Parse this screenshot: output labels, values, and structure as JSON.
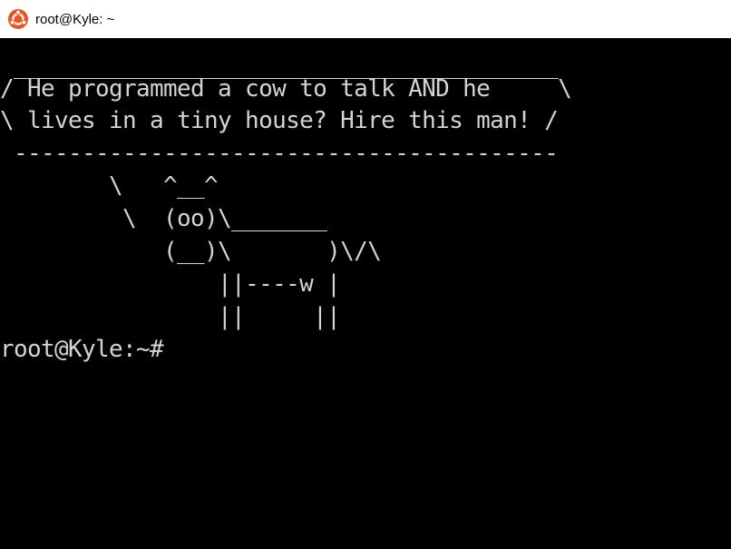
{
  "window": {
    "title": "root@Kyle: ~",
    "app_icon": "ubuntu-logo-icon",
    "accent_color": "#e95420"
  },
  "terminal": {
    "background": "#000000",
    "foreground": "#d4d4d4",
    "lines": [
      " ________________________________________",
      "/ He programmed a cow to talk AND he     \\",
      "\\ lives in a tiny house? Hire this man! /",
      " ----------------------------------------",
      "        \\   ^__^",
      "         \\  (oo)\\_______",
      "            (__)\\       )\\/\\",
      "                ||----w |",
      "                ||     ||",
      "root@Kyle:~#"
    ]
  }
}
